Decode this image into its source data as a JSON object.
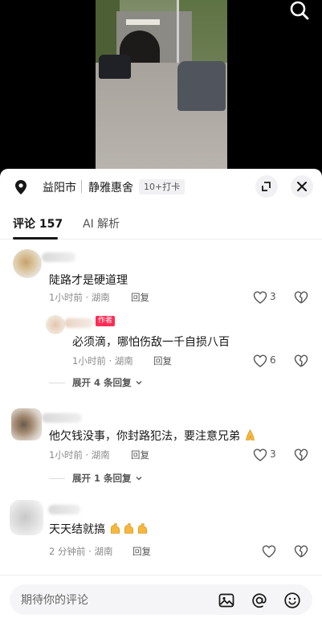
{
  "location": {
    "city": "益阳市",
    "place": "静雅惠舍",
    "badge": "10+打卡"
  },
  "tabs": [
    {
      "label": "评论 157"
    },
    {
      "label": "AI 解析"
    }
  ],
  "comments": [
    {
      "text": "陡路才是硬道理",
      "meta": "1小时前 · 湖南",
      "reply_label": "回复",
      "likes": "3"
    },
    {
      "badge": "作者",
      "text": "必须滴，哪怕伤敌一千自损八百",
      "meta": "1小时前 · 湖南",
      "reply_label": "回复",
      "likes": "6"
    },
    {
      "expand": "展开 4 条回复"
    },
    {
      "text": "他欠钱没事，你封路犯法，要注意兄弟",
      "meta": "1小时前 · 湖南",
      "reply_label": "回复",
      "likes": "3"
    },
    {
      "expand": "展开 1 条回复"
    },
    {
      "text": "天天结就搞",
      "meta": "2 分钟前 · 湖南",
      "reply_label": "回复"
    }
  ],
  "input": {
    "placeholder": "期待你的评论"
  },
  "colors": {
    "accent": "#fe2c55",
    "emoji": "#f6b83c"
  }
}
